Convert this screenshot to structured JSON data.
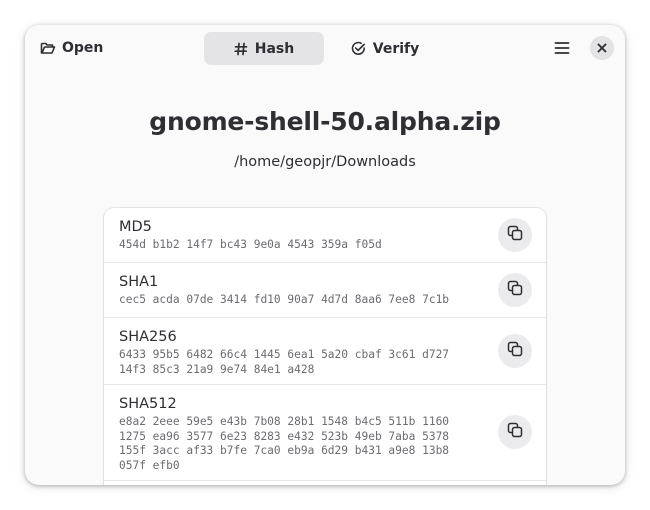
{
  "header": {
    "open_label": "Open",
    "tabs": [
      {
        "label": "Hash",
        "icon": "hash-icon",
        "selected": true
      },
      {
        "label": "Verify",
        "icon": "check-circle-icon",
        "selected": false
      }
    ],
    "menu_icon": "hamburger-menu-icon",
    "close_icon": "close-icon"
  },
  "file": {
    "name": "gnome-shell-50.alpha.zip",
    "path": "/home/geopjr/Downloads"
  },
  "hashes": [
    {
      "algorithm": "MD5",
      "digest": "454d b1b2 14f7 bc43 9e0a 4543 359a f05d"
    },
    {
      "algorithm": "SHA1",
      "digest": "cec5 acda 07de 3414 fd10 90a7 4d7d 8aa6 7ee8 7c1b"
    },
    {
      "algorithm": "SHA256",
      "digest": "6433 95b5 6482 66c4 1445 6ea1 5a20 cbaf 3c61 d727 14f3 85c3 21a9 9e74 84e1 a428"
    },
    {
      "algorithm": "SHA512",
      "digest": "e8a2 2eee 59e5 e43b 7b08 28b1 1548 b4c5 511b 1160 1275 ea96 3577 6e23 8283 e432 523b 49eb 7aba 5378 155f 3acc af33 b7fe 7ca0 eb9a 6d29 b431 a9e8 13b8 057f efb0"
    }
  ],
  "colors": {
    "text": "#2e2e33",
    "digest_text": "#6b6b70",
    "selected_tab_bg": "#e4e4e7",
    "window_bg": "#fafafb"
  }
}
